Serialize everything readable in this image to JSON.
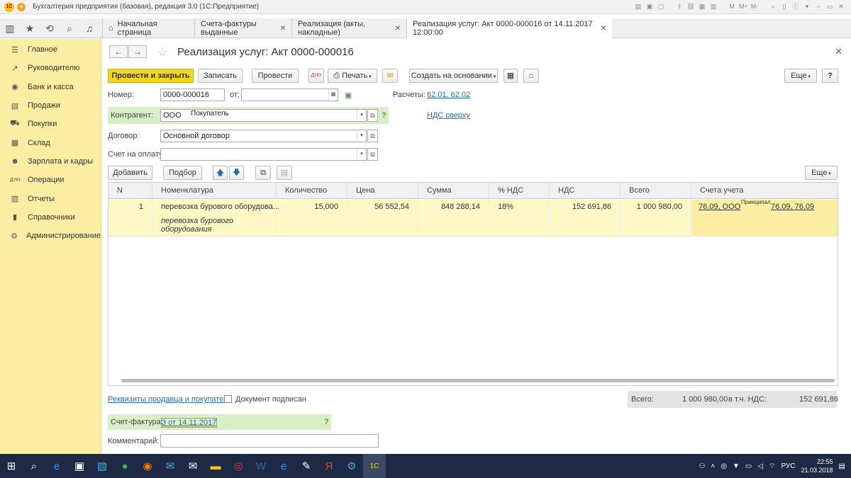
{
  "window": {
    "title": "Бухгалтерия предприятия (базовая), редакция 3.0 (1С:Предприятие)"
  },
  "tabs": [
    {
      "label": "Начальная страница"
    },
    {
      "label": "Счета-фактуры выданные"
    },
    {
      "label": "Реализация (акты, накладные)"
    },
    {
      "label": "Реализация услуг: Акт 0000-000016 от 14.11.2017 12:00:00"
    }
  ],
  "sidebar": {
    "items": [
      {
        "label": "Главное",
        "icon": "menu-icon"
      },
      {
        "label": "Руководителю",
        "icon": "trend-icon"
      },
      {
        "label": "Банк и касса",
        "icon": "coins-icon"
      },
      {
        "label": "Продажи",
        "icon": "cart-icon"
      },
      {
        "label": "Покупки",
        "icon": "truck-icon"
      },
      {
        "label": "Склад",
        "icon": "warehouse-icon"
      },
      {
        "label": "Зарплата и кадры",
        "icon": "people-icon"
      },
      {
        "label": "Операции",
        "icon": "dtkt-icon"
      },
      {
        "label": "Отчеты",
        "icon": "chart-icon"
      },
      {
        "label": "Справочники",
        "icon": "book-icon"
      },
      {
        "label": "Администрирование",
        "icon": "gear-icon"
      }
    ]
  },
  "document": {
    "title": "Реализация услуг: Акт 0000-000016"
  },
  "toolbar": {
    "post_close": "Провести и закрыть",
    "save": "Записать",
    "post": "Провести",
    "print": "Печать",
    "create_based": "Создать на основании",
    "more": "Еще",
    "help": "?"
  },
  "form": {
    "number_label": "Номер:",
    "number_value": "0000-000016",
    "date_label": "от:",
    "date_value": "",
    "accounts_label": "Расчеты:",
    "accounts_value": "62.01, 62.02",
    "counterparty_label": "Контрагент:",
    "counterparty_value": "ООО",
    "counterparty_note": "Покупатель",
    "vat_link": "НДС сверху",
    "contract_label": "Договор:",
    "contract_value": "Основной договор",
    "invoice_label": "Счет на оплату:",
    "invoice_value": ""
  },
  "table_toolbar": {
    "add": "Добавить",
    "pick": "Подбор",
    "more": "Еще"
  },
  "table": {
    "columns": [
      "N",
      "Номенклатура",
      "Количество",
      "Цена",
      "Сумма",
      "% НДС",
      "НДС",
      "Всего",
      "Счета учета"
    ],
    "rows": [
      {
        "n": "1",
        "item": "перевозка бурового оборудова...",
        "item_desc": "перевозка бурового оборудования",
        "qty": "15,000",
        "price": "56 552,54",
        "sum": "848 288,14",
        "vat_rate": "18%",
        "vat": "152 691,86",
        "total": "1 000 980,00",
        "accounts": "76.09, ООО",
        "accounts_tail": "76.09, 76.09",
        "accounts_note": "Принципал"
      }
    ]
  },
  "footer": {
    "requisites_link": "Реквизиты продавца и покупателя",
    "signed_label": "Документ подписан",
    "total_label": "Всего:",
    "total_value": "1 000 980,00",
    "vat_label": "в т.ч. НДС:",
    "vat_value": "152 691,86",
    "invoice_label": "Счет-фактура:",
    "invoice_link": "3 от 14.11.2017",
    "comment_label": "Комментарий:",
    "comment_value": ""
  },
  "taskbar": {
    "lang": "РУС",
    "time": "22:55",
    "date": "21.03.2018"
  }
}
